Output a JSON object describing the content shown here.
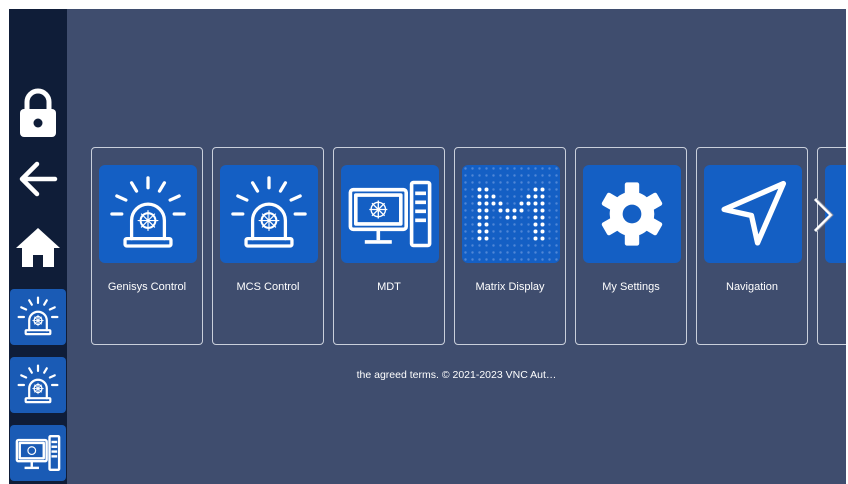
{
  "sidebar": {
    "items": [
      {
        "icon": "lock-icon"
      },
      {
        "icon": "back-arrow-icon"
      },
      {
        "icon": "home-icon"
      },
      {
        "icon": "alarm-beacon-icon"
      },
      {
        "icon": "alarm-beacon-icon"
      },
      {
        "icon": "computer-icon"
      }
    ]
  },
  "apps": [
    {
      "label": "Genisys Control",
      "icon": "alarm-beacon-icon"
    },
    {
      "label": "MCS Control",
      "icon": "alarm-beacon-icon"
    },
    {
      "label": "MDT",
      "icon": "computer-icon"
    },
    {
      "label": "Matrix Display",
      "icon": "matrix-display-icon"
    },
    {
      "label": "My Settings",
      "icon": "gear-icon"
    },
    {
      "label": "Navigation",
      "icon": "navigation-arrow-icon"
    }
  ],
  "footer_text": "the agreed terms. © 2021-2023 VNC Aut…",
  "colors": {
    "background": "#3f4d6e",
    "sidebar": "#0f1d38",
    "tile_icon_bg": "#145fc4",
    "tile_border": "#c9cfdb"
  }
}
